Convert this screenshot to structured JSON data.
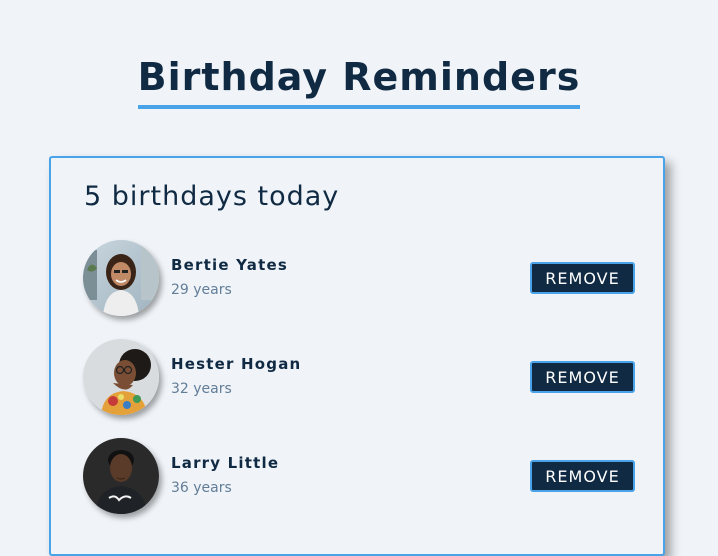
{
  "header": {
    "title": "Birthday Reminders"
  },
  "summary": {
    "count_text": "5 birthdays today"
  },
  "people": [
    {
      "name": "Bertie Yates",
      "age": "29 years",
      "avatar_icon": "person-photo-avatar",
      "remove_label": "REMOVE"
    },
    {
      "name": "Hester Hogan",
      "age": "32 years",
      "avatar_icon": "person-photo-avatar",
      "remove_label": "REMOVE"
    },
    {
      "name": "Larry Little",
      "age": "36 years",
      "avatar_icon": "person-photo-avatar",
      "remove_label": "REMOVE"
    }
  ],
  "colors": {
    "background": "#f0f4f8",
    "primary_dark": "#102a43",
    "accent_blue": "#48a3e8",
    "muted_text": "#627d98"
  }
}
